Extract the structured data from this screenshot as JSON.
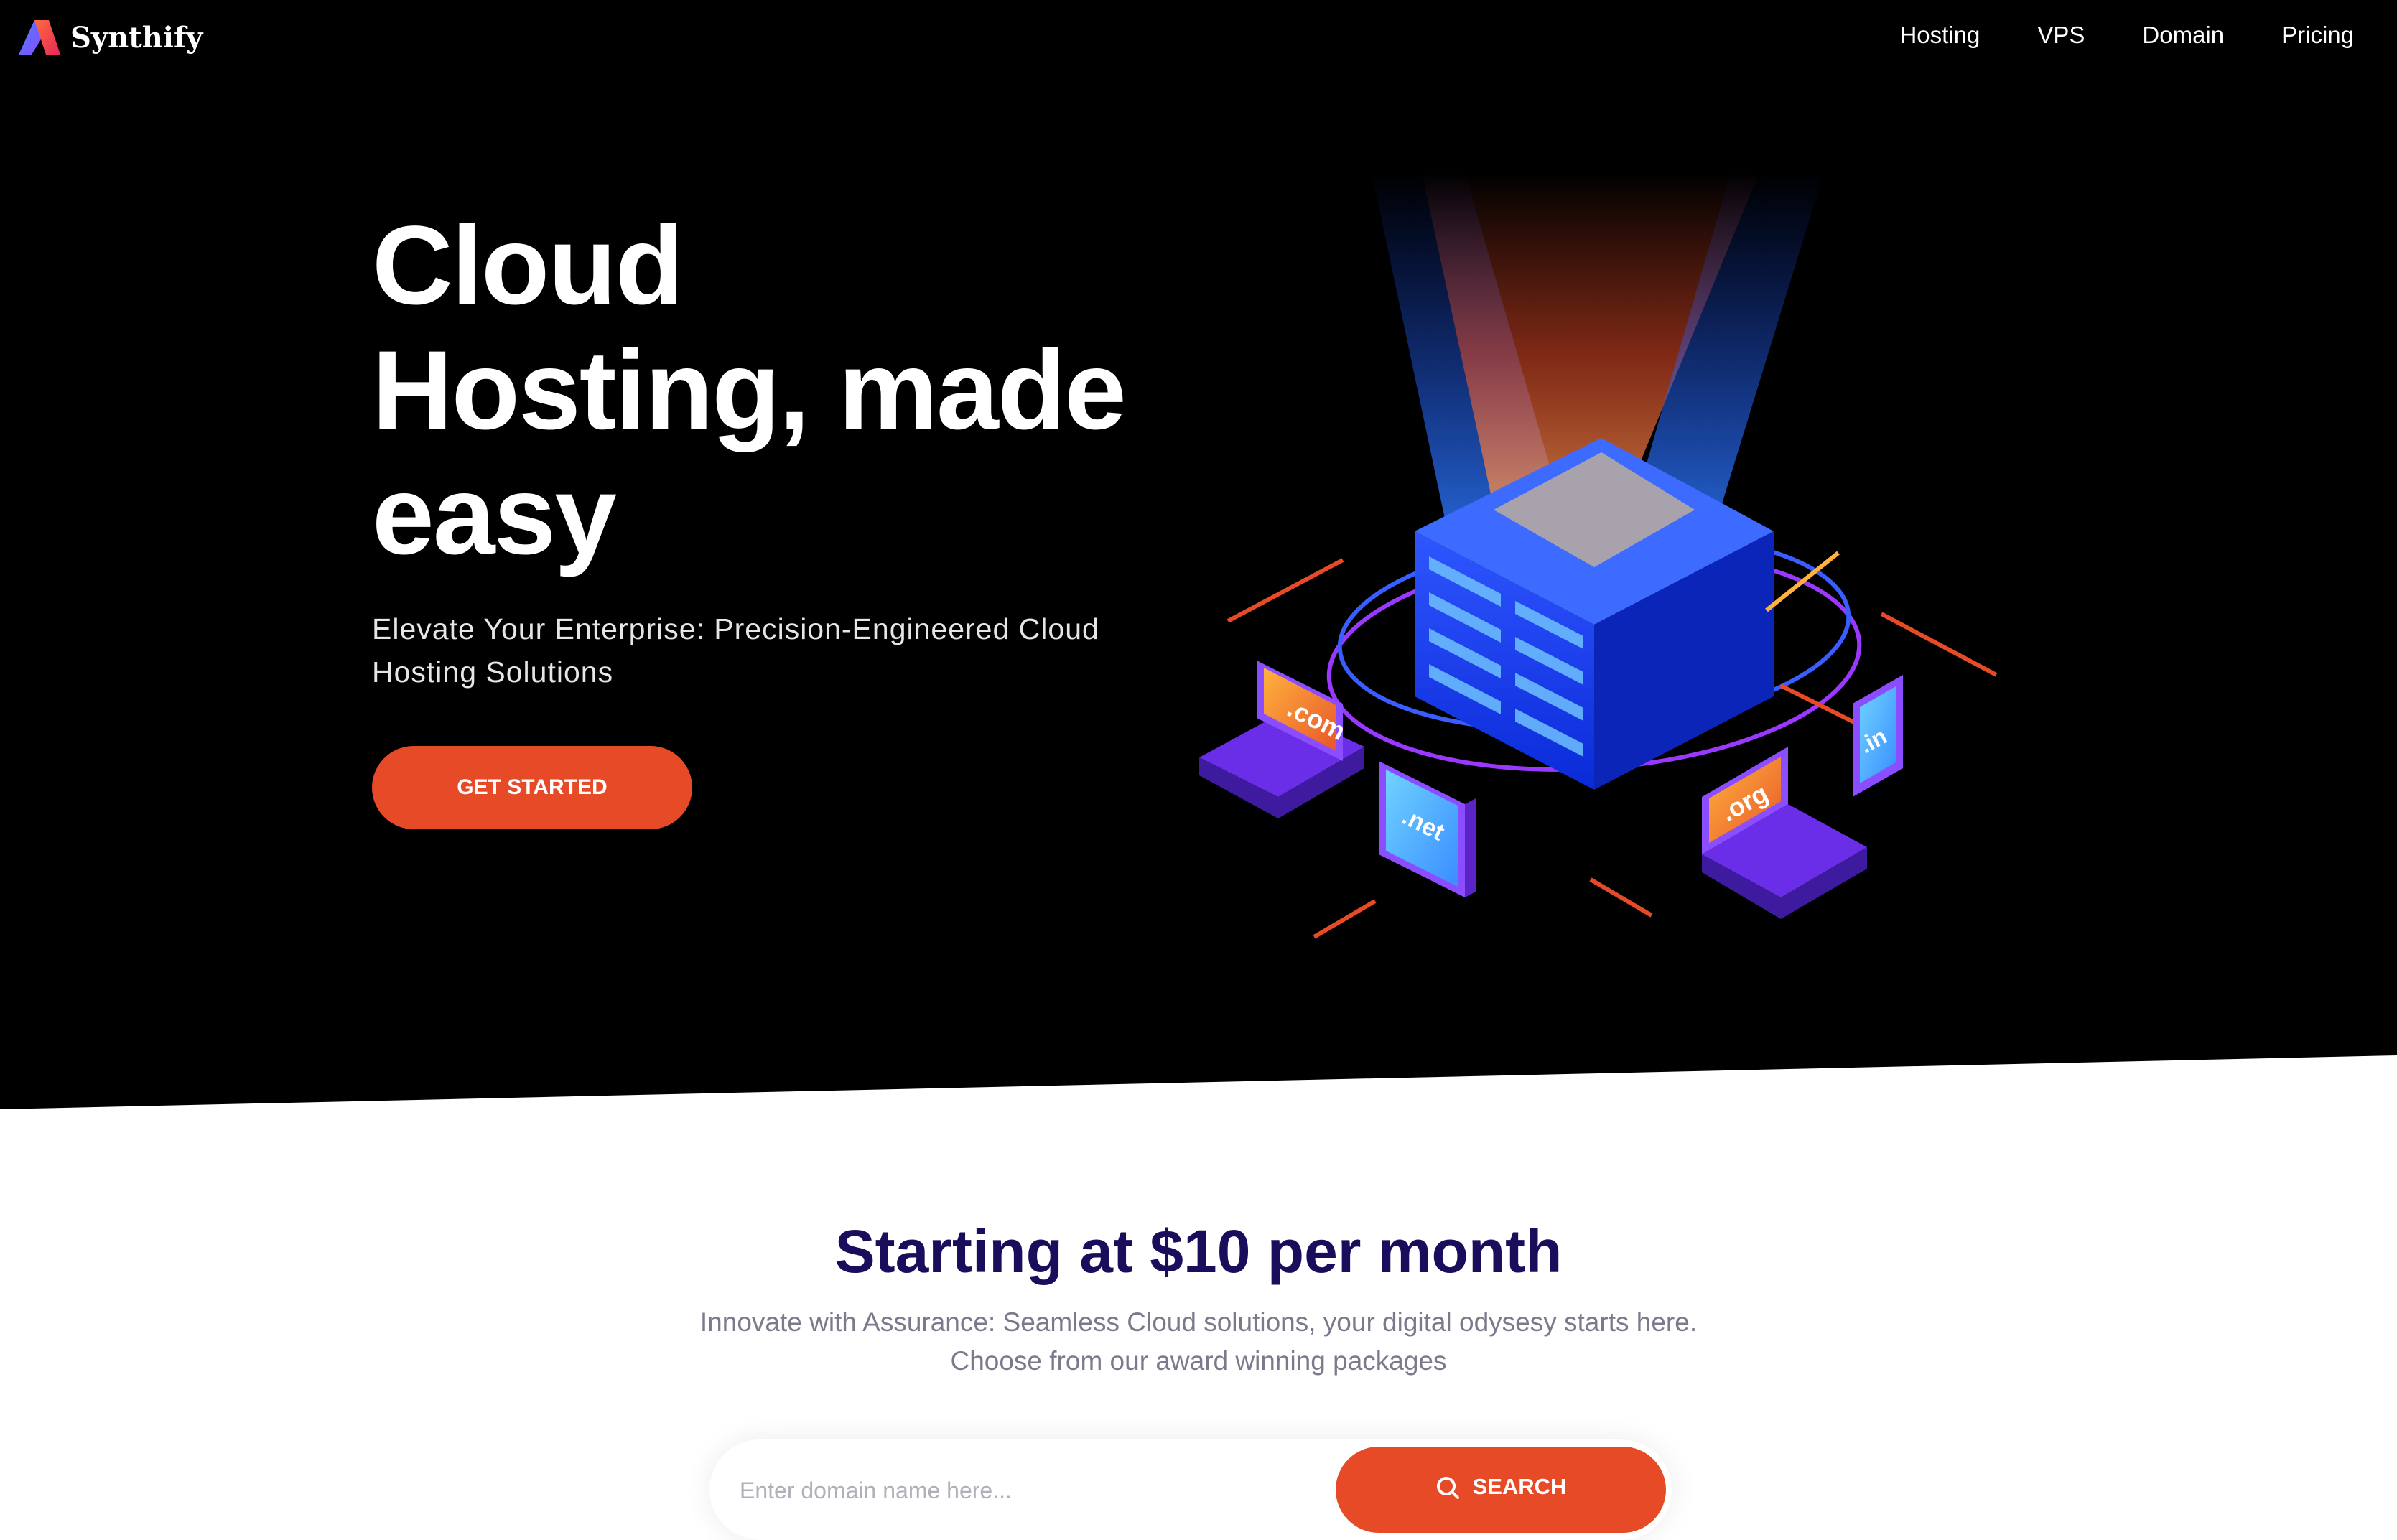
{
  "brand": {
    "name": "Synthify"
  },
  "nav": {
    "items": [
      "Hosting",
      "VPS",
      "Domain",
      "Pricing"
    ]
  },
  "hero": {
    "title_lines": [
      "Cloud",
      "Hosting, made",
      "easy"
    ],
    "subtitle": "Elevate Your Enterprise: Precision-Engineered Cloud Hosting Solutions",
    "cta_label": "GET STARTED",
    "illustration": {
      "domain_tags": [
        ".com",
        ".net",
        ".org",
        ".in"
      ]
    }
  },
  "pricing": {
    "title": "Starting at $10 per month",
    "desc_line1": "Innovate with Assurance: Seamless Cloud solutions, your digital odysesy starts here.",
    "desc_line2": "Choose from our award winning packages"
  },
  "search": {
    "placeholder": "Enter domain name here...",
    "button_label": "SEARCH",
    "icon": "search-icon"
  },
  "colors": {
    "accent": "#e64a27",
    "hero_bg": "#000000",
    "heading": "#1a0e5c",
    "muted": "#7a7a8c"
  }
}
